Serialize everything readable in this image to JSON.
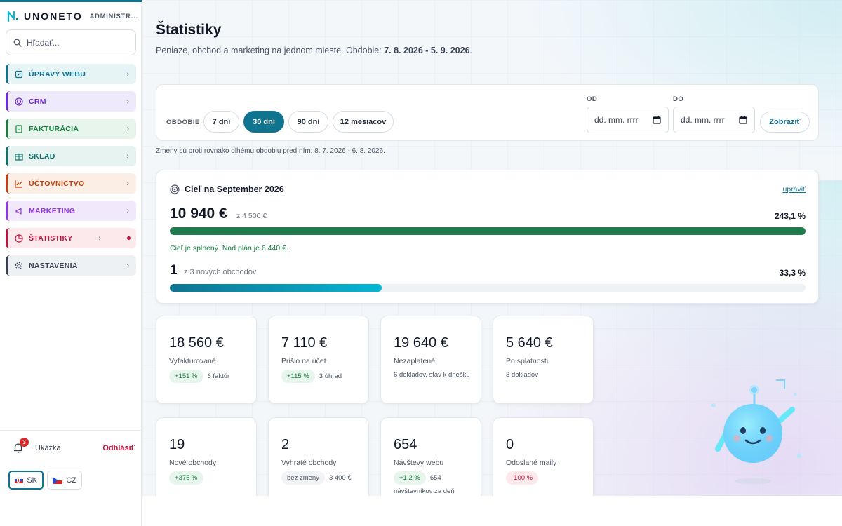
{
  "brand": {
    "name": "UNONETO",
    "sub": "ADMINISTR..."
  },
  "search": {
    "placeholder": "Hľadať..."
  },
  "nav": [
    {
      "label": "ÚPRAVY WEBU",
      "color": "#0e7490",
      "bg": "#e6f4f6",
      "icon": "edit-icon"
    },
    {
      "label": "CRM",
      "color": "#6d28d9",
      "bg": "#efeafb",
      "icon": "target-icon"
    },
    {
      "label": "FAKTURÁCIA",
      "color": "#15803d",
      "bg": "#e7f5ec",
      "icon": "invoice-icon"
    },
    {
      "label": "SKLAD",
      "color": "#0f766e",
      "bg": "#e6f3f1",
      "icon": "box-icon"
    },
    {
      "label": "ÚČTOVNÍCTVO",
      "color": "#c2410c",
      "bg": "#fbeee5",
      "icon": "chart-line-icon"
    },
    {
      "label": "MARKETING",
      "color": "#9333ea",
      "bg": "#f1e8fb",
      "icon": "megaphone-icon"
    },
    {
      "label": "ŠTATISTIKY",
      "color": "#be123c",
      "bg": "#fbe9ec",
      "icon": "pie-icon"
    },
    {
      "label": "NASTAVENIA",
      "color": "#374151",
      "bg": "#eef1f4",
      "icon": "gear-icon"
    }
  ],
  "user": {
    "notifications": "3",
    "name": "Ukážka",
    "logout": "Odhlásiť"
  },
  "langs": [
    {
      "code": "SK",
      "active": true
    },
    {
      "code": "CZ",
      "active": false
    }
  ],
  "page": {
    "title": "Štatistiky",
    "subtitle_prefix": "Peniaze, obchod a marketing na jednom mieste. Obdobie: ",
    "subtitle_period": "7. 8. 2026 - 5. 9. 2026",
    "subtitle_suffix": "."
  },
  "period": {
    "label": "OBDOBIE",
    "options": [
      "7 dní",
      "30 dní",
      "90 dní",
      "12 mesiacov"
    ],
    "active_index": 1,
    "from_label": "OD",
    "to_label": "DO",
    "date_placeholder": "dd. mm. rrrr",
    "show_button": "Zobraziť",
    "compare_note": "Zmeny sú proti rovnako dlhému obdobiu pred ním: 8. 7. 2026 - 6. 8. 2026."
  },
  "goal": {
    "title": "Cieľ na September 2026",
    "edit": "upraviť",
    "amount": "10 940 €",
    "of_amount": "z 4 500 €",
    "amount_pct": "243,1 %",
    "amount_progress": 1.0,
    "ok_text": "Cieľ je splnený. Nad plán je 6 440 €.",
    "deals": "1",
    "deals_of": "z 3 nových obchodov",
    "deals_pct": "33,3 %",
    "deals_progress": 0.333
  },
  "kpis_row1": [
    {
      "value": "18 560 €",
      "label": "Vyfakturované",
      "chip": "+151 %",
      "chip_type": "up",
      "note": "6 faktúr"
    },
    {
      "value": "7 110 €",
      "label": "Prišlo na účet",
      "chip": "+115 %",
      "chip_type": "up",
      "note": "3 úhrad"
    },
    {
      "value": "19 640 €",
      "label": "Nezaplatené",
      "sub": "6 dokladov, stav k dnešku"
    },
    {
      "value": "5 640 €",
      "label": "Po splatnosti",
      "sub": "3 dokladov"
    }
  ],
  "kpis_row2": [
    {
      "value": "19",
      "label": "Nové obchody",
      "chip": "+375 %",
      "chip_type": "up"
    },
    {
      "value": "2",
      "label": "Vyhraté obchody",
      "chip": "bez zmeny",
      "chip_type": "neutral",
      "note": "3 400 €"
    },
    {
      "value": "654",
      "label": "Návštevy webu",
      "chip": "+1,2 %",
      "chip_type": "up",
      "note": "654",
      "sub": "návštevníkov za deň (súčet)"
    },
    {
      "value": "0",
      "label": "Odoslané maily",
      "chip": "-100 %",
      "chip_type": "down"
    }
  ]
}
